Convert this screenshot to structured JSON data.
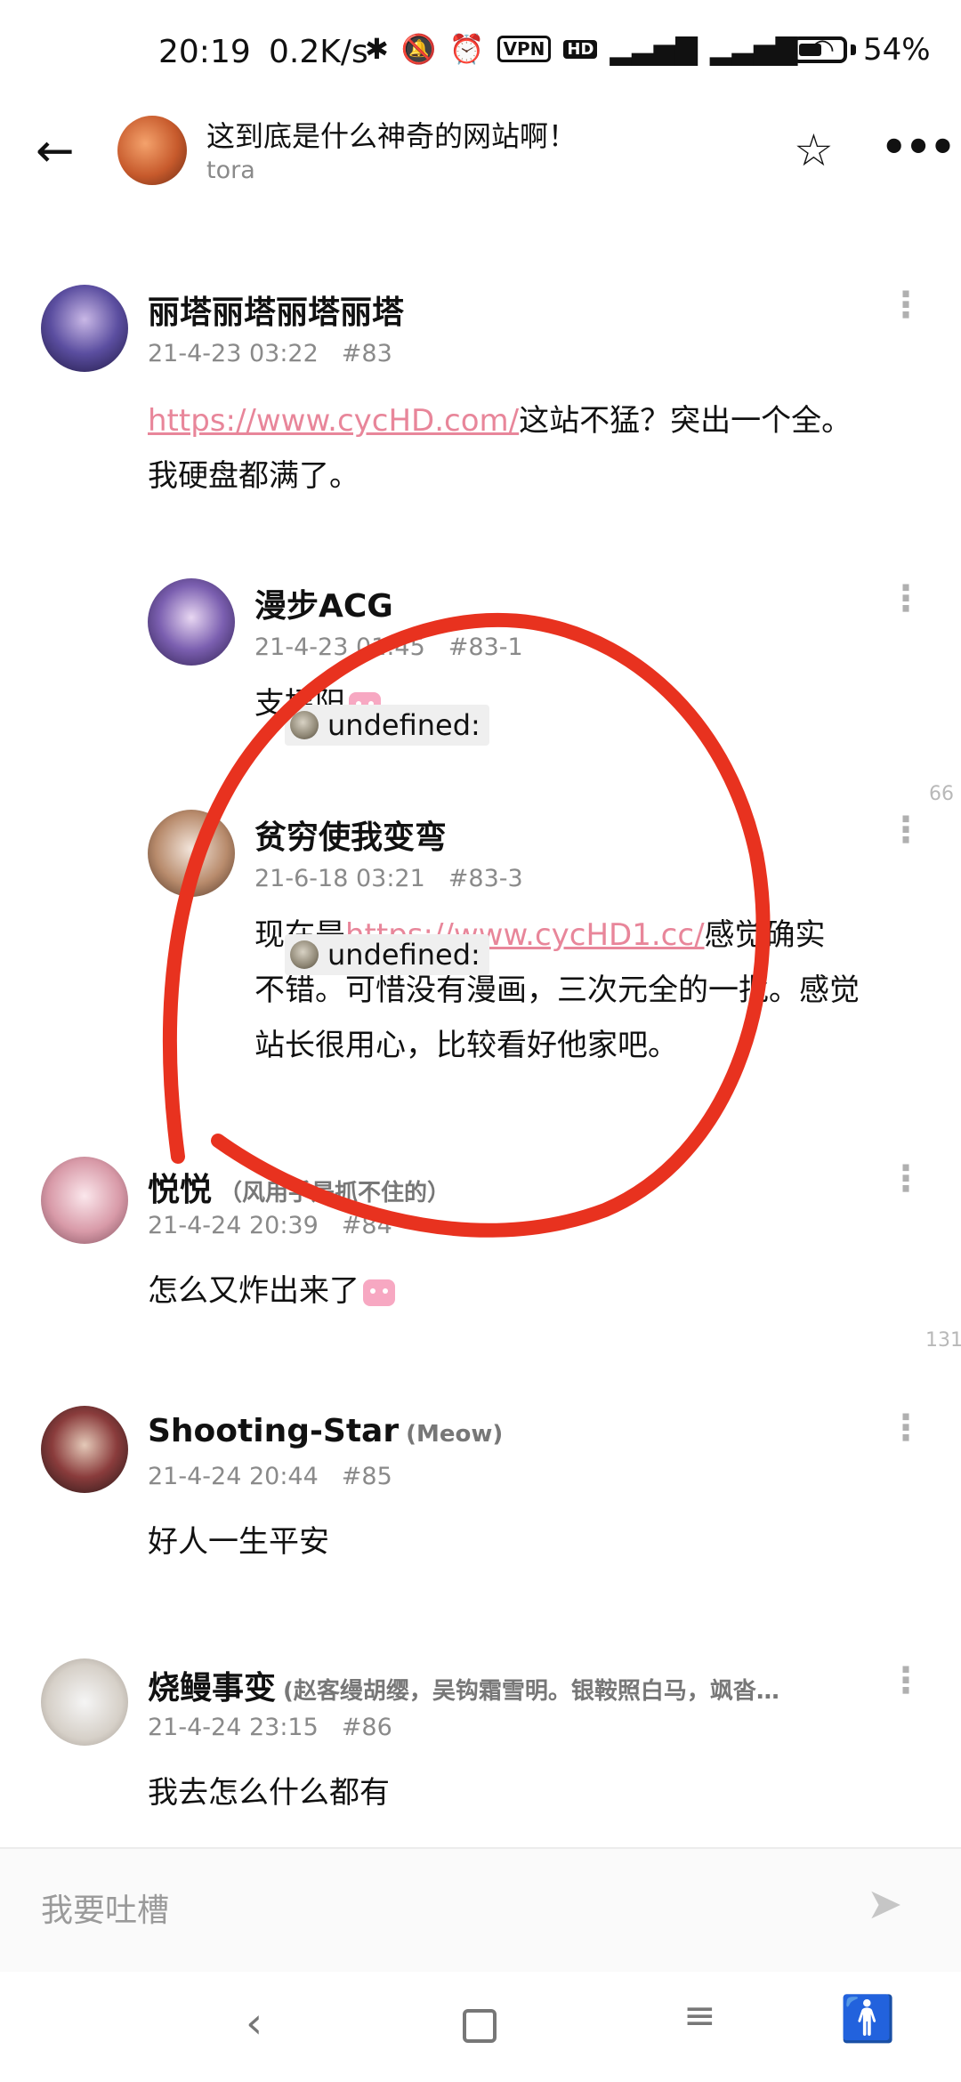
{
  "status_bar": {
    "time": "20:19",
    "speed": "0.2K/s",
    "icons": [
      "bluetooth-icon",
      "mute-icon",
      "alarm-icon",
      "vpn-icon",
      "hd-icon",
      "signal-4g-icon",
      "signal-4g-icon",
      "wifi-icon"
    ],
    "vpn": "VPN",
    "hd": "HD",
    "battery_level": 0.54,
    "battery": "54%"
  },
  "app_bar": {
    "title": "这到底是什么神奇的网站啊！",
    "author": "tora"
  },
  "posts": [
    {
      "name": "丽塔丽塔丽塔丽塔",
      "signature": "",
      "date": "21-4-23 03:22",
      "floor": "#83",
      "link": "https://www.cycHD.com/",
      "text_after_link": "这站不猛？突出一个全。",
      "text_line2": "我硬盘都满了。"
    },
    {
      "name": "漫步ACG",
      "date": "21-4-23 01:45",
      "floor": "#83-1",
      "text": "支招阳"
    },
    {
      "name": "贫穷使我变弯",
      "date": "21-6-18 03:21",
      "floor": "#83-3",
      "text_before_link": "现在是",
      "link": "https://www.cycHD1.cc/",
      "text_after_link": "感觉确实",
      "text_line2": "不错。可惜没有漫画，三次元全的一批。感觉",
      "text_line3": "站长很用心，比较看好他家吧。"
    },
    {
      "name": "悦悦",
      "signature": "（风用手是抓不住的）",
      "date": "21-4-24 20:39",
      "floor": "#84",
      "text": "怎么又炸出来了"
    },
    {
      "name": "Shooting-Star",
      "signature": "(Meow)",
      "date": "21-4-24 20:44",
      "floor": "#85",
      "text": "好人一生平安"
    },
    {
      "name": "烧鳗事变",
      "signature": "(赵客缦胡缨，吴钩霜雪明。银鞍照白马，飒沓…",
      "date": "21-4-24 23:15",
      "floor": "#86",
      "text": "我去怎么什么都有"
    }
  ],
  "overlay_tags": [
    "undefined:",
    "undefined:"
  ],
  "side_numbers": [
    "66",
    "131"
  ],
  "input": {
    "placeholder": "我要吐槽"
  }
}
